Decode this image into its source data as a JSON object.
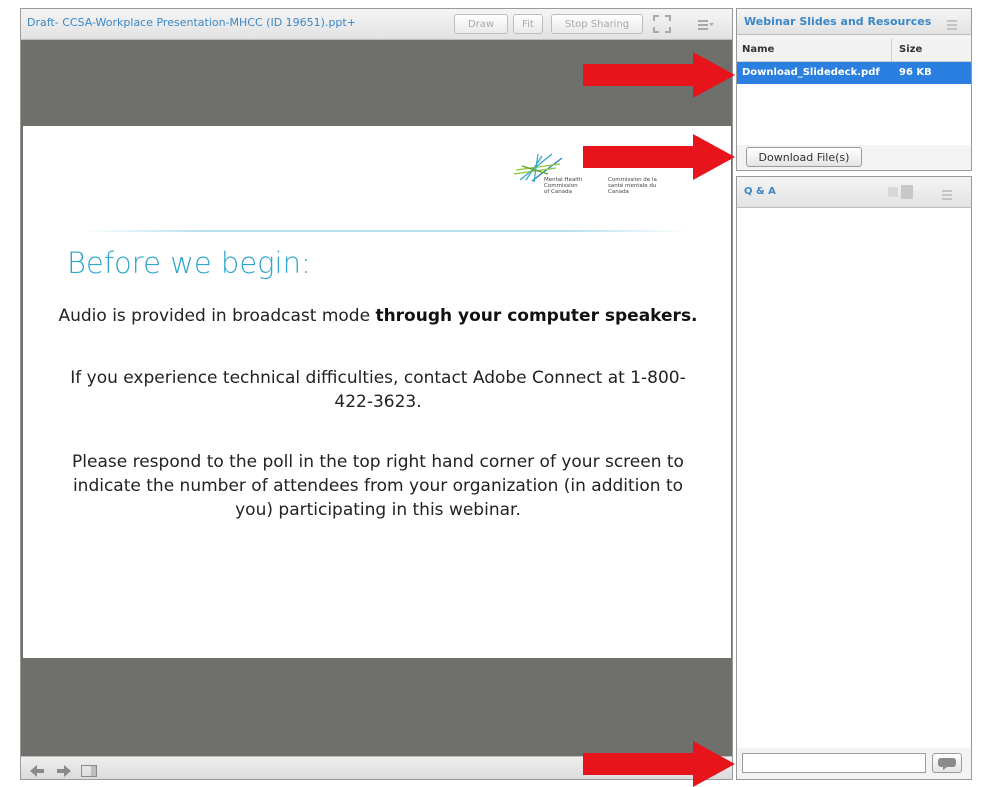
{
  "share_pod": {
    "title": "Draft- CCSA-Workplace Presentation-MHCC (ID 19651).ppt+",
    "toolbar": {
      "draw_label": "Draw",
      "fit_label": "Fit",
      "stop_sharing_label": "Stop Sharing"
    },
    "slide": {
      "logo_en": "Mental Health Commission of Canada",
      "logo_fr": "Commission de la santé mentale du Canada",
      "heading": "Before we begin:",
      "p1_normal": "Audio is provided in broadcast mode ",
      "p1_bold": "through your computer speakers.",
      "p2": "If you experience technical difficulties, contact Adobe Connect at 1-800-422-3623.",
      "p3": "Please respond to the poll in the top right hand corner of your screen to indicate the number of attendees from your organization (in addition to you) participating in this webinar."
    }
  },
  "files_pod": {
    "title": "Webinar Slides and Resources",
    "columns": {
      "name": "Name",
      "size": "Size"
    },
    "rows": [
      {
        "name": "Download_Slidedeck.pdf",
        "size": "96 KB"
      }
    ],
    "download_label": "Download File(s)"
  },
  "chat_pod": {
    "title": "Q & A"
  },
  "colors": {
    "accent": "#3b87c8",
    "slide_heading": "#2fa6cc",
    "selected_row": "#2b7fe0",
    "arrow": "#e8141b",
    "stage": "#6f706c"
  }
}
